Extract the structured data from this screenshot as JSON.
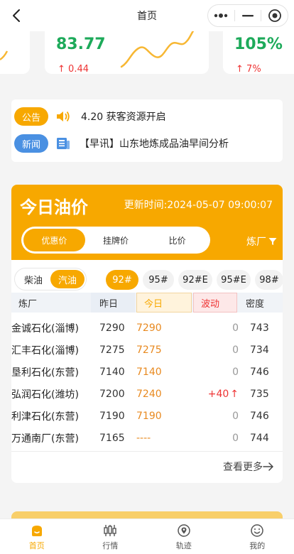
{
  "nav": {
    "title": "首页"
  },
  "stats": {
    "card2": {
      "value": "83.77",
      "change": "0.44"
    },
    "card3": {
      "value": "105%",
      "change": "7%"
    }
  },
  "notices": [
    {
      "tag": "公告",
      "text": "4.20 获客资源开启"
    },
    {
      "tag": "新闻",
      "text": "【早讯】山东地炼成品油早间分析"
    }
  ],
  "oil": {
    "title": "今日油价",
    "update_time": "更新时间:2024-05-07 09:00:07",
    "tabs": [
      "优惠价",
      "挂牌价",
      "比价"
    ],
    "active_tab": 0,
    "refinery_filter": "炼厂",
    "fuel_types": [
      "柴油",
      "汽油"
    ],
    "active_fuel": 1,
    "grades": [
      "92#",
      "95#",
      "92#E",
      "95#E",
      "98#"
    ],
    "active_grade": 0,
    "columns": [
      "炼厂",
      "昨日",
      "今日",
      "波动",
      "密度"
    ],
    "rows": [
      {
        "name": "金诚石化(淄博)",
        "yesterday": "7290",
        "today": "7290",
        "change": "0",
        "density": "743"
      },
      {
        "name": "汇丰石化(淄博)",
        "yesterday": "7275",
        "today": "7275",
        "change": "0",
        "density": "734"
      },
      {
        "name": "垦利石化(东营)",
        "yesterday": "7140",
        "today": "7140",
        "change": "0",
        "density": "746"
      },
      {
        "name": "弘润石化(潍坊)",
        "yesterday": "7200",
        "today": "7240",
        "change": "+40",
        "density": "735"
      },
      {
        "name": "利津石化(东营)",
        "yesterday": "7190",
        "today": "7190",
        "change": "0",
        "density": "746"
      },
      {
        "name": "万通南厂(东营)",
        "yesterday": "7165",
        "today": "----",
        "change": "0",
        "density": "744"
      }
    ],
    "more": "查看更多"
  },
  "tabbar": [
    {
      "label": "首页",
      "icon": "home-icon"
    },
    {
      "label": "行情",
      "icon": "candlestick-icon"
    },
    {
      "label": "轨迹",
      "icon": "location-icon"
    },
    {
      "label": "我的",
      "icon": "smile-icon"
    }
  ],
  "colors": {
    "accent": "#f7a800",
    "up": "#e33333",
    "green": "#1daa5a",
    "blue": "#4a90e2"
  }
}
